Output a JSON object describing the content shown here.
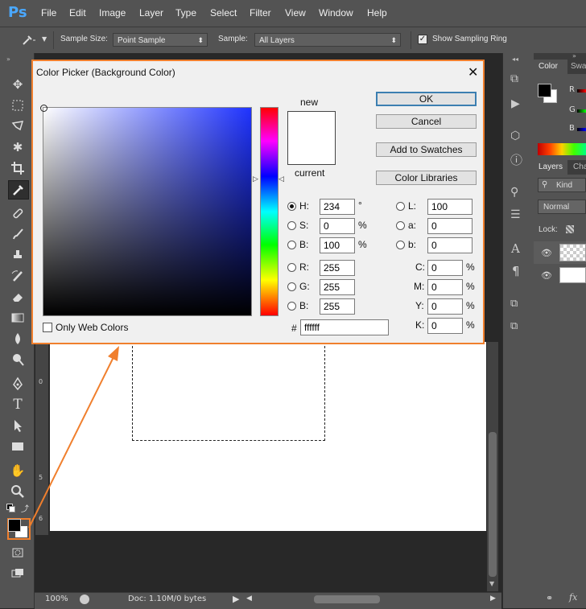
{
  "app": {
    "logo": "Ps"
  },
  "menu": [
    "File",
    "Edit",
    "Image",
    "Layer",
    "Type",
    "Select",
    "Filter",
    "View",
    "Window",
    "Help"
  ],
  "options": {
    "sample_size_label": "Sample Size:",
    "sample_size_value": "Point Sample",
    "sample_label": "Sample:",
    "sample_value": "All Layers",
    "show_ring_label": "Show Sampling Ring"
  },
  "right_panel": {
    "color_tab": "Color",
    "swatches_tab": "Swa",
    "layers_tab": "Layers",
    "channels_tab": "Cha",
    "kind": "Kind",
    "blend_mode": "Normal",
    "lock_label": "Lock:",
    "rgb": [
      "R",
      "G",
      "B"
    ]
  },
  "status": {
    "zoom": "100%",
    "doc": "Doc: 1.10M/0 bytes"
  },
  "ruler_marks": [
    "0",
    "5",
    "6"
  ],
  "dialog": {
    "title": "Color Picker (Background Color)",
    "new_label": "new",
    "current_label": "current",
    "buttons": {
      "ok": "OK",
      "cancel": "Cancel",
      "add_swatches": "Add to Swatches",
      "libraries": "Color Libraries"
    },
    "hsb": {
      "h_label": "H:",
      "h": "234",
      "h_unit": "°",
      "s_label": "S:",
      "s": "0",
      "s_unit": "%",
      "b_label": "B:",
      "b": "100",
      "b_unit": "%"
    },
    "rgb": {
      "r_label": "R:",
      "r": "255",
      "g_label": "G:",
      "g": "255",
      "b_label": "B:",
      "b": "255"
    },
    "lab": {
      "l_label": "L:",
      "l": "100",
      "a_label": "a:",
      "a": "0",
      "b_label": "b:",
      "b": "0"
    },
    "cmyk": {
      "c_label": "C:",
      "c": "0",
      "m_label": "M:",
      "m": "0",
      "y_label": "Y:",
      "y": "0",
      "k_label": "K:",
      "k": "0",
      "unit": "%"
    },
    "hex_label": "#",
    "hex": "ffffff",
    "web_only_label": "Only Web Colors"
  },
  "colors": {
    "accent": "#f07f2d",
    "hue_field": "#1f33ff",
    "foreground": "#000000",
    "background": "#ffffff"
  }
}
